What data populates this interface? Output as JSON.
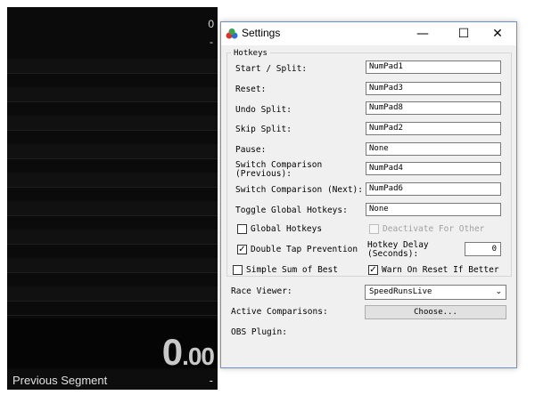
{
  "timer_panel": {
    "top_split_value": "0",
    "row_dash": "-",
    "timer_whole": "0",
    "timer_fraction": ".00",
    "previous_segment_label": "Previous Segment",
    "previous_segment_value": "-"
  },
  "settings": {
    "window_title": "Settings",
    "controls": {
      "minimize": "—",
      "maximize": "☐",
      "close": "✕"
    },
    "hotkeys_group_label": "Hotkeys",
    "hotkeys": [
      {
        "label": "Start / Split:",
        "value": "NumPad1"
      },
      {
        "label": "Reset:",
        "value": "NumPad3"
      },
      {
        "label": "Undo Split:",
        "value": "NumPad8"
      },
      {
        "label": "Skip Split:",
        "value": "NumPad2"
      },
      {
        "label": "Pause:",
        "value": "None"
      },
      {
        "label": "Switch Comparison\n(Previous):",
        "value": "NumPad4"
      },
      {
        "label": "Switch Comparison (Next):",
        "value": "NumPad6"
      },
      {
        "label": "Toggle Global Hotkeys:",
        "value": "None"
      }
    ],
    "global_hotkeys_label": "Global Hotkeys",
    "deactivate_for_other_label": "Deactivate For Other",
    "double_tap_label": "Double Tap Prevention",
    "hotkey_delay_label": "Hotkey Delay\n(Seconds):",
    "hotkey_delay_value": "0",
    "simple_sum_label": "Simple Sum of Best",
    "warn_on_reset_label": "Warn On Reset If Better",
    "race_viewer_label": "Race Viewer:",
    "race_viewer_value": "SpeedRunsLive",
    "active_comparisons_label": "Active Comparisons:",
    "choose_button_label": "Choose...",
    "obs_plugin_label": "OBS Plugin:",
    "checkbox_states": {
      "global_hotkeys": false,
      "deactivate_for_other": false,
      "double_tap_prevention": true,
      "simple_sum_of_best": false,
      "warn_on_reset": true
    },
    "check_glyph": "✓",
    "dropdown_arrow": "⌄"
  }
}
